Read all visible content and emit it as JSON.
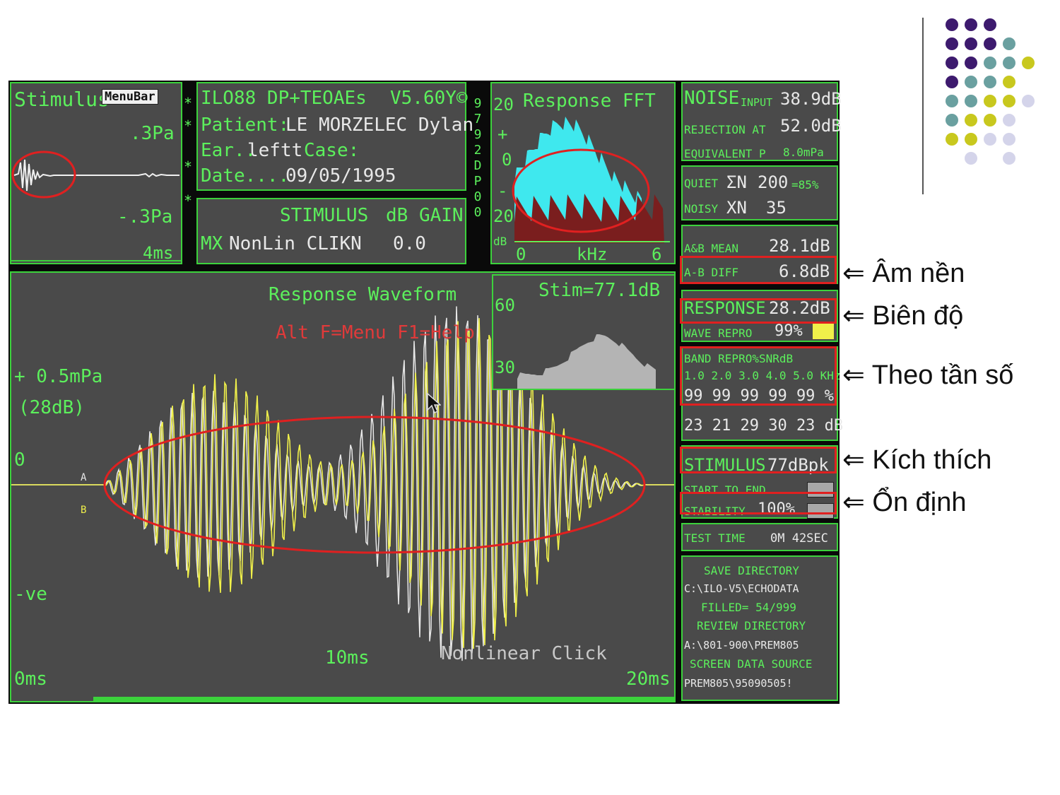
{
  "stimulus_panel": {
    "title": "Stimulus",
    "menu_label": "MenuBar",
    "top_scale": ".3Pa",
    "bottom_scale": "-.3Pa",
    "time": "4ms",
    "markers": [
      "*",
      "*",
      "*",
      "*",
      "*"
    ]
  },
  "info_panel": {
    "system": "ILO88  DP+TEOAEs",
    "version": "V5.60Y©",
    "patient_label": "Patient:",
    "patient_name": "LE MORZELEC Dylan",
    "ear_label": "Ear..",
    "ear_value": "leftt",
    "case_label": "Case:",
    "date_label": "Date....",
    "date_value": "09/05/1995",
    "serial_vertical": [
      "9",
      "7",
      "9",
      "2",
      "D",
      "P",
      "0",
      "0"
    ]
  },
  "gain_panel": {
    "stimulus_label": "STIMULUS",
    "db_gain_label": "dB GAIN",
    "mode": "MX",
    "mode_value": "NonLin CLIKN",
    "gain_value": "0.0"
  },
  "fft_panel": {
    "title": "Response FFT",
    "y_labels": [
      "20",
      "+",
      "0",
      "-",
      "20"
    ],
    "y_unit": "dB",
    "x_start": "0",
    "x_unit": "kHz",
    "x_end": "6"
  },
  "waveform_panel": {
    "title": "Response Waveform",
    "hint": "Alt F=Menu F1=Help",
    "scale_plus": "+ 0.5mPa",
    "scale_db": "(28dB)",
    "zero": "0",
    "minus": "-ve",
    "marker_a": "A",
    "marker_b": "B",
    "t_start": "0ms",
    "t_mid": "10ms",
    "t_end": "20ms",
    "caption": "Nonlinear Click"
  },
  "stim_spectrum": {
    "title": "Stim=77.1dB",
    "y_top": "60",
    "y_bottom": "30"
  },
  "stats": {
    "noise_label": "NOISE",
    "input_label": "INPUT",
    "input_value": "38.9dB",
    "rejection_label": "REJECTION AT",
    "rejection_value": "52.0dB",
    "equivalent_label": "EQUIVALENT P",
    "equivalent_value": "8.0mPa",
    "quiet_label": "QUIET",
    "quiet_sym": "ΣN",
    "quiet_value": "200",
    "quiet_pct": "=85%",
    "noisy_label": "NOISY",
    "noisy_sym": "XN",
    "noisy_value": "35",
    "ab_mean_label": "A&B MEAN",
    "ab_mean_value": "28.1dB",
    "ab_diff_label": "A-B DIFF",
    "ab_diff_value": "6.8dB",
    "response_label": "RESPONSE",
    "response_value": "28.2dB",
    "wave_repro_label": "WAVE REPRO",
    "wave_repro_value": "99%",
    "band_label": "BAND REPRO%SNRdB",
    "band_freqs": "1.0 2.0 3.0 4.0 5.0 KHz",
    "band_repro": "99 99 99 99 99 %",
    "band_snr": "23 21 29 30 23 dB",
    "stimulus_label": "STIMULUS",
    "stimulus_value": "77dBpk",
    "start_end_label": "START TO END",
    "stability_label": "STABILITY",
    "stability_value": "100%",
    "test_time_label": "TEST TIME",
    "test_time_value": "0M 42SEC",
    "save_dir_label": "SAVE DIRECTORY",
    "save_dir_value": "C:\\ILO-V5\\ECHODATA",
    "filled_label": "FILLED= 54/999",
    "review_dir_label": "REVIEW DIRECTORY",
    "review_dir_value": "A:\\801-900\\PREM805",
    "screen_src_label": "SCREEN DATA SOURCE",
    "screen_src_value": "PREM805\\95090505!"
  },
  "annotations": {
    "noise": "Âm nền",
    "amplitude": "Biên độ",
    "frequency": "Theo tần số",
    "stimulus": "Kích thích",
    "stability": "Ổn định",
    "arrow": "⇐"
  },
  "colors": {
    "screen_green": "#5cf05c",
    "panel_gray": "#4a4a4a",
    "highlight_red": "#e02020",
    "wave_yellow": "#f0f04a",
    "fft_cyan": "#3fe8ee",
    "fft_darkred": "#7a1e1e",
    "dot_purple": "#3d1a6e",
    "dot_teal": "#6aa0a0",
    "dot_lime": "#c8c81e",
    "dot_lavender": "#d4d4ea"
  }
}
